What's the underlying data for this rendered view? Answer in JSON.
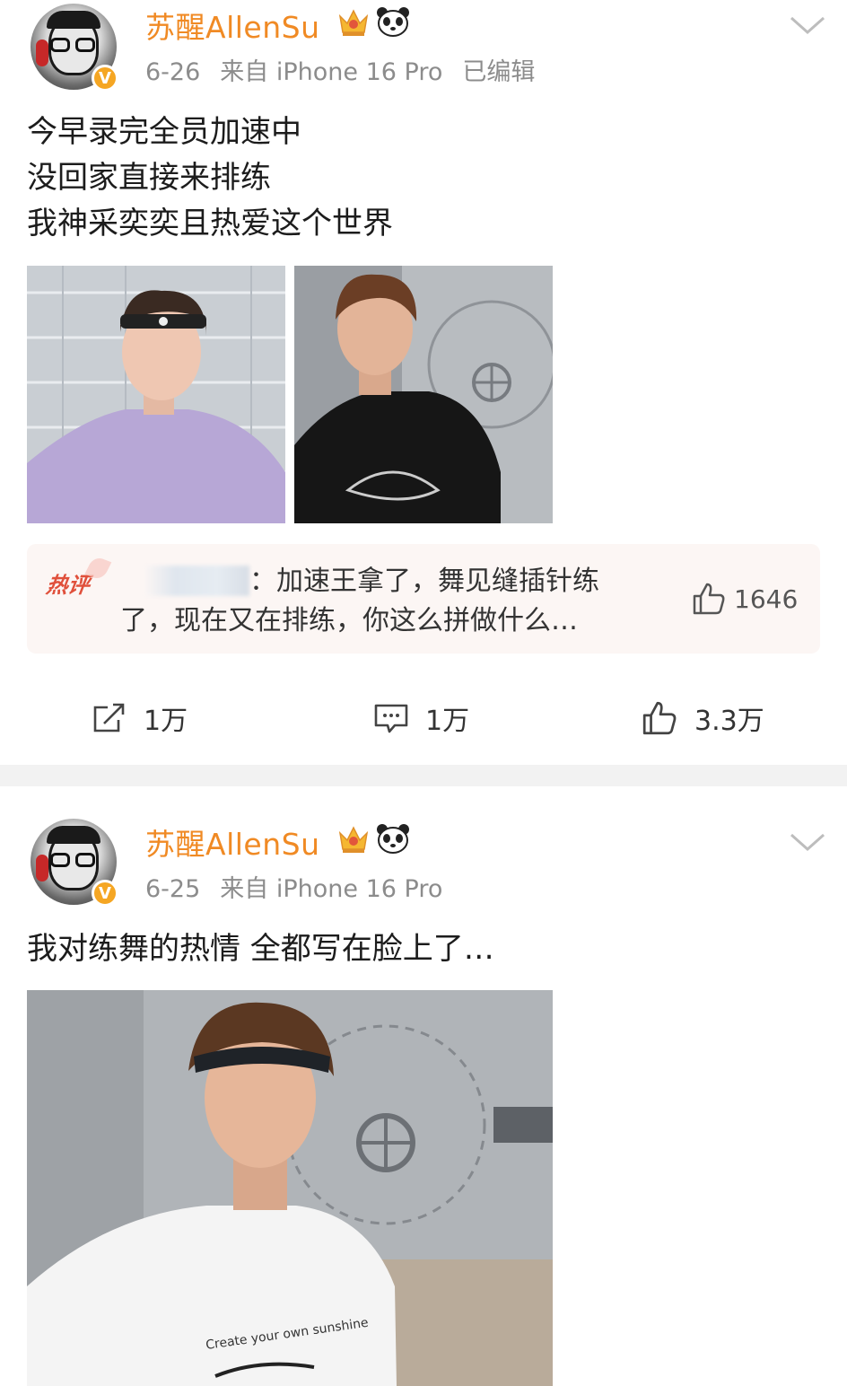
{
  "posts": [
    {
      "author": "苏醒AllenSu",
      "date": "6-26",
      "source": "来自 iPhone 16 Pro",
      "edited": "已编辑",
      "text_lines": [
        "今早录完全员加速中",
        "没回家直接来排练",
        "我神采奕奕且热爱这个世界"
      ],
      "hot_comment": {
        "tag": "热评",
        "line1": "：加速王拿了，舞见缝插针练",
        "line2": "了，现在又在排练，你这么拼做什么…",
        "likes": "1646"
      },
      "actions": {
        "repost": "1万",
        "comment": "1万",
        "like": "3.3万"
      }
    },
    {
      "author": "苏醒AllenSu",
      "date": "6-25",
      "source": "来自 iPhone 16 Pro",
      "text_lines": [
        "我对练舞的热情 全都写在脸上了…"
      ],
      "shirt_text": "Create your own sunshine"
    }
  ],
  "colors": {
    "username": "#f08a24",
    "meta": "#8c8c8c",
    "hot_tag": "#e0503b",
    "verified": "#f5a623"
  },
  "icons": [
    "verified-badge-icon",
    "crown-icon",
    "panda-icon",
    "chevron-down-icon",
    "repost-icon",
    "comment-icon",
    "like-icon"
  ]
}
